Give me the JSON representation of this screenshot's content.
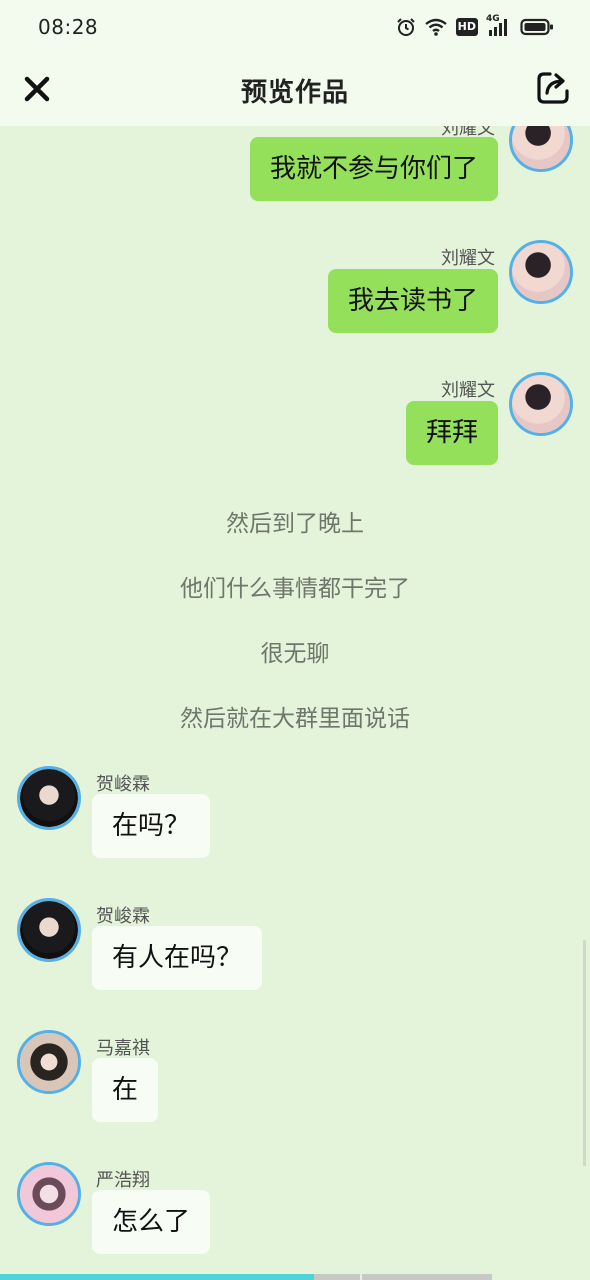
{
  "status_bar": {
    "time": "08:28",
    "icons": [
      "alarm-icon",
      "wifi-icon",
      "hd-icon",
      "signal-4g-icon",
      "battery-icon"
    ],
    "hd_label": "HD",
    "network_label": "4G"
  },
  "nav": {
    "title": "预览作品",
    "close_icon": "close-icon",
    "share_icon": "share-icon"
  },
  "messages": [
    {
      "side": "right",
      "sender": "刘耀文",
      "text": "我就不参与你们了"
    },
    {
      "side": "right",
      "sender": "刘耀文",
      "text": "我去读书了"
    },
    {
      "side": "right",
      "sender": "刘耀文",
      "text": "拜拜"
    },
    {
      "side": "center",
      "text": "然后到了晚上"
    },
    {
      "side": "center",
      "text": "他们什么事情都干完了"
    },
    {
      "side": "center",
      "text": "很无聊"
    },
    {
      "side": "center",
      "text": "然后就在大群里面说话"
    },
    {
      "side": "left",
      "sender": "贺峻霖",
      "text": "在吗？"
    },
    {
      "side": "left",
      "sender": "贺峻霖",
      "text": "有人在吗？"
    },
    {
      "side": "left",
      "sender": "马嘉祺",
      "text": "在"
    },
    {
      "side": "left",
      "sender": "严浩翔",
      "text": "怎么了"
    }
  ],
  "colors": {
    "background": "#e4f4da",
    "header": "#f2fbee",
    "right_bubble": "#95e05a",
    "left_bubble": "#f7fcf4",
    "avatar_ring": "#56b0e8",
    "progress": "#4fd3d9"
  }
}
